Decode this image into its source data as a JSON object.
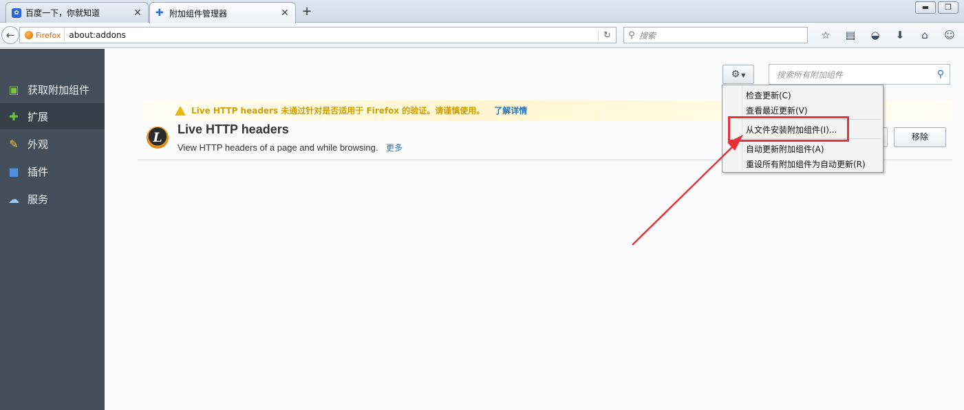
{
  "tabs": [
    {
      "label": "百度一下，你就知道",
      "icon": "baidu-paw-icon",
      "active": false
    },
    {
      "label": "附加组件管理器",
      "icon": "puzzle-icon",
      "active": true
    }
  ],
  "navbar": {
    "identity_label": "Firefox",
    "url": "about:addons",
    "search_placeholder": "搜索"
  },
  "sidebar": {
    "items": [
      {
        "label": "获取附加组件",
        "icon": "get-addons-icon",
        "selected": false
      },
      {
        "label": "扩展",
        "icon": "puzzle-icon",
        "selected": true
      },
      {
        "label": "外观",
        "icon": "palette-icon",
        "selected": false
      },
      {
        "label": "插件",
        "icon": "plugin-block-icon",
        "selected": false
      },
      {
        "label": "服务",
        "icon": "speech-bubble-icon",
        "selected": false
      }
    ]
  },
  "main": {
    "addon_search_placeholder": "搜索所有附加组件",
    "warning": {
      "text": "Live HTTP headers 未通过针对是否适用于 Firefox 的验证。请谨慎使用。",
      "link": "了解详情"
    },
    "addon": {
      "name": "Live HTTP headers",
      "description": "View HTTP headers of a page and while browsing.",
      "more_link": "更多",
      "icon_letter": "L",
      "remove_label": "移除"
    }
  },
  "tools_menu": {
    "items": [
      "检查更新(C)",
      "查看最近更新(V)",
      "从文件安装附加组件(I)...",
      "自动更新附加组件(A)",
      "重设所有附加组件为自动更新(R)"
    ],
    "highlighted_index": 2
  },
  "colors": {
    "sidebar_bg": "#424f5a",
    "sidebar_selected": "#343f48",
    "annotation_red": "#e8303a",
    "link_blue": "#2476c7",
    "warning_yellow": "#d19f00"
  }
}
